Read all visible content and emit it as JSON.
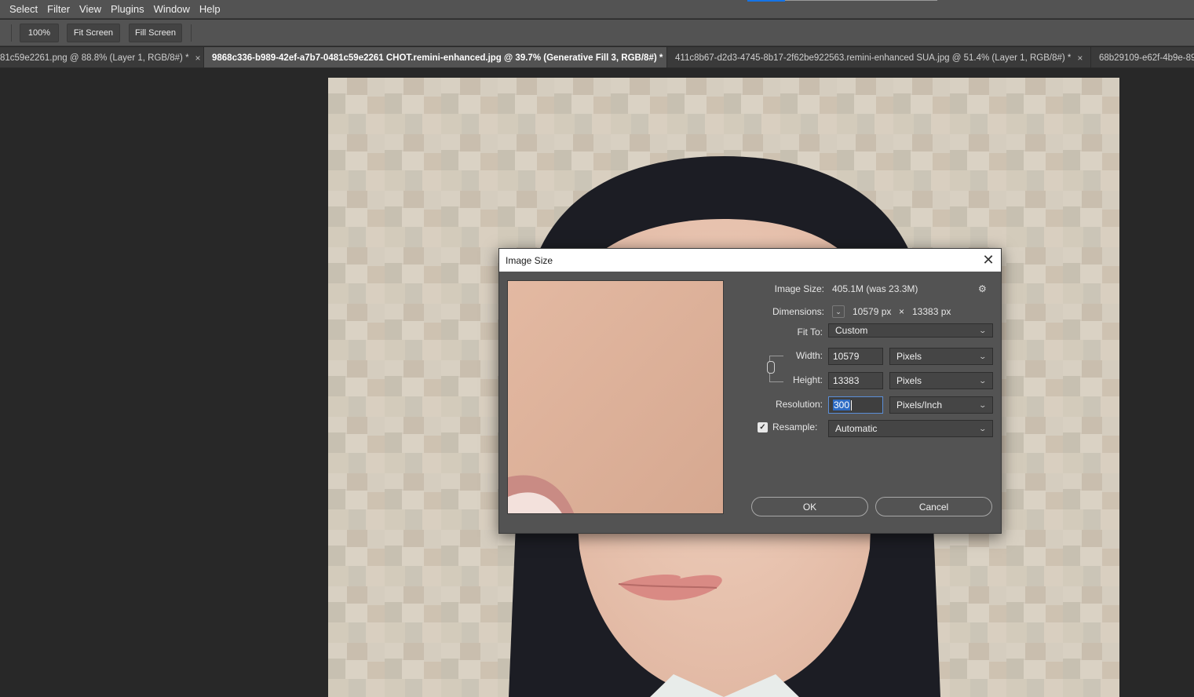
{
  "menubar": {
    "items": [
      "Select",
      "Filter",
      "View",
      "Plugins",
      "Window",
      "Help"
    ]
  },
  "options": {
    "zoom_100": "100%",
    "fit_screen": "Fit Screen",
    "fill_screen": "Fill Screen"
  },
  "tabs": [
    {
      "label": "81c59e2261.png @ 88.8% (Layer 1, RGB/8#) *",
      "close": "×"
    },
    {
      "label": "9868c336-b989-42ef-a7b7-0481c59e2261 CHOT.remini-enhanced.jpg @ 39.7% (Generative Fill 3, RGB/8#) *",
      "close": "×"
    },
    {
      "label": "411c8b67-d2d3-4745-8b17-2f62be922563.remini-enhanced SUA.jpg @ 51.4% (Layer 1, RGB/8#) *",
      "close": "×"
    },
    {
      "label": "68b29109-e62f-4b9e-89",
      "close": ""
    }
  ],
  "dialog": {
    "title": "Image Size",
    "close_glyph": "✕",
    "image_size_label": "Image Size:",
    "image_size_value": "405.1M (was 23.3M)",
    "gear_glyph": "⚙",
    "dimensions_label": "Dimensions:",
    "dim_width": "10579 px",
    "dim_times": "×",
    "dim_height": "13383 px",
    "fit_to_label": "Fit To:",
    "fit_to_value": "Custom",
    "width_label": "Width:",
    "width_value": "10579",
    "width_unit": "Pixels",
    "height_label": "Height:",
    "height_value": "13383",
    "height_unit": "Pixels",
    "resolution_label": "Resolution:",
    "resolution_value": "300",
    "resolution_unit": "Pixels/Inch",
    "resample_label": "Resample:",
    "resample_checked_glyph": "✓",
    "resample_value": "Automatic",
    "ok": "OK",
    "cancel": "Cancel",
    "chevron": "⌄"
  },
  "colors": {
    "menubar_bg": "#535353",
    "canvas_bg": "#282828",
    "dialog_bg": "#535353",
    "accent": "#1473e6",
    "selection": "#2d6bc4"
  }
}
